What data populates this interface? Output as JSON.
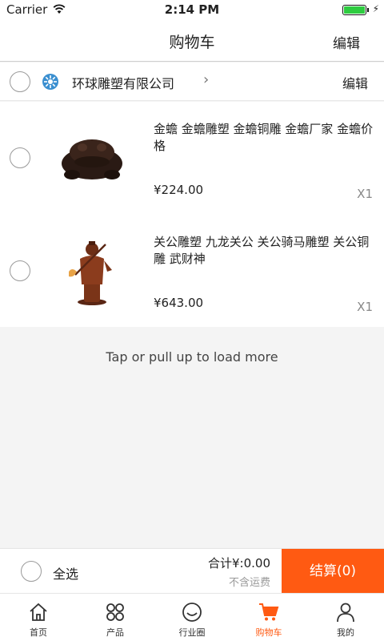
{
  "status": {
    "carrier": "Carrier",
    "time": "2:14 PM"
  },
  "nav": {
    "title": "购物车",
    "edit": "编辑"
  },
  "shop": {
    "name": "环球雕塑有限公司",
    "edit": "编辑"
  },
  "items": [
    {
      "name": "金蟾 金蟾雕塑 金蟾铜雕 金蟾厂家 金蟾价格",
      "price": "¥224.00",
      "qty": "X1"
    },
    {
      "name": "关公雕塑 九龙关公 关公骑马雕塑 关公铜雕 武财神",
      "price": "¥643.00",
      "qty": "X1"
    }
  ],
  "load_more": "Tap or pull up to load more",
  "checkout": {
    "select_all": "全选",
    "total": "合计¥:0.00",
    "shipping": "不含运费",
    "pay": "结算(0)"
  },
  "tabs": [
    {
      "label": "首页",
      "icon": "home-icon"
    },
    {
      "label": "产品",
      "icon": "grid-icon"
    },
    {
      "label": "行业圈",
      "icon": "smile-icon"
    },
    {
      "label": "购物车",
      "icon": "cart-icon",
      "active": true
    },
    {
      "label": "我的",
      "icon": "person-icon"
    }
  ],
  "colors": {
    "accent": "#ff5a12",
    "battery": "#2ecc40"
  }
}
